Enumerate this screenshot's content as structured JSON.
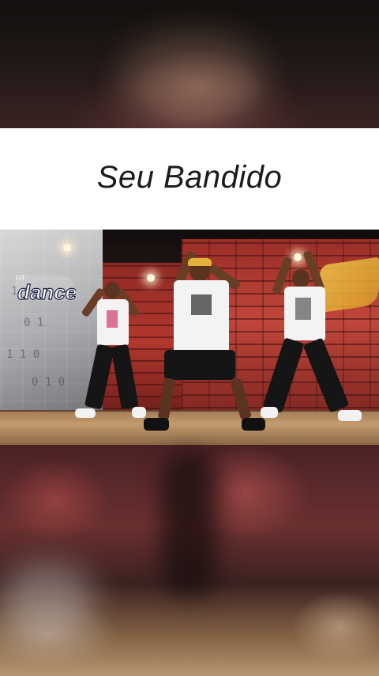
{
  "caption": {
    "text": "Seu Bandido"
  },
  "video": {
    "logo_text": "dance",
    "logo_prefix": "FIT"
  },
  "colors": {
    "caption_background": "#ffffff",
    "caption_text": "#1b1b1b",
    "brick_wall": "#b2372d",
    "concrete_wall": "#a9aaad",
    "floor": "#c49b6d"
  }
}
